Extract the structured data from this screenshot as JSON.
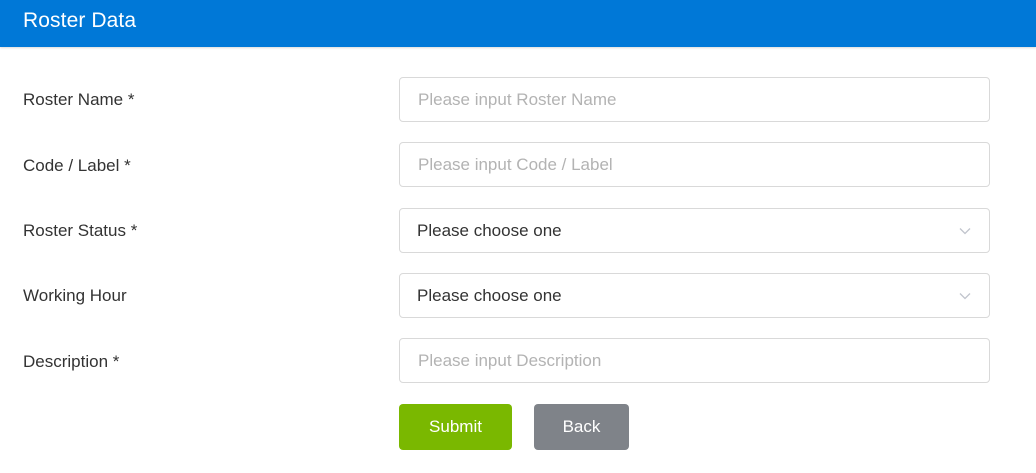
{
  "header": {
    "title": "Roster Data"
  },
  "form": {
    "roster_name": {
      "label": "Roster Name *",
      "placeholder": "Please input Roster Name",
      "value": ""
    },
    "code_label": {
      "label": "Code / Label *",
      "placeholder": "Please input Code / Label",
      "value": ""
    },
    "roster_status": {
      "label": "Roster Status *",
      "selected": "Please choose one",
      "icon": "chevron-down-icon"
    },
    "working_hour": {
      "label": "Working Hour",
      "selected": "Please choose one",
      "icon": "chevron-down-icon"
    },
    "description": {
      "label": "Description *",
      "placeholder": "Please input Description",
      "value": ""
    }
  },
  "actions": {
    "submit_label": "Submit",
    "back_label": "Back"
  },
  "colors": {
    "header_bg": "#0078d7",
    "submit_bg": "#7ab800",
    "back_bg": "#7f8389"
  }
}
